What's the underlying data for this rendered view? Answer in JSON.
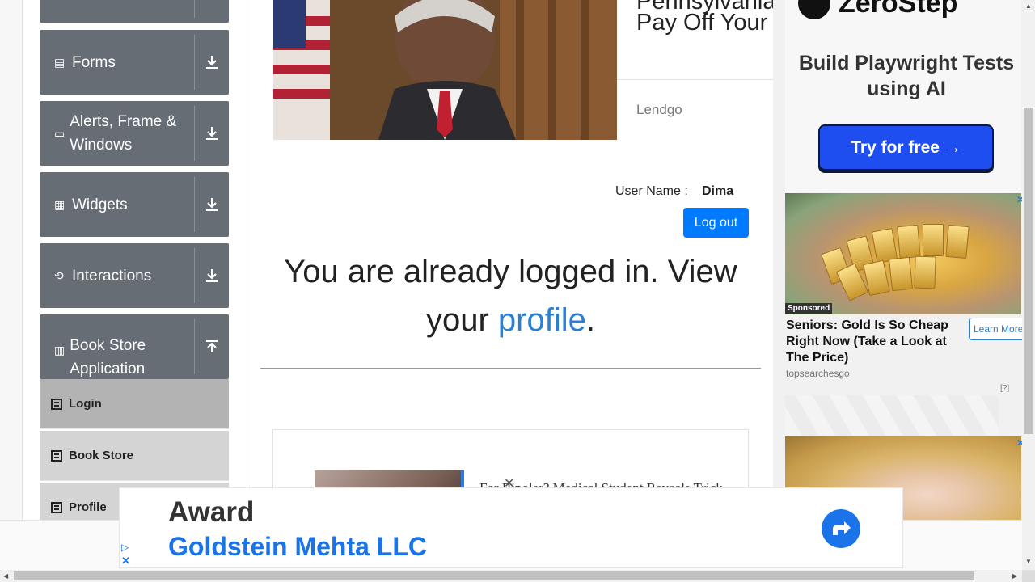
{
  "sidebar": {
    "groups": [
      {
        "label": "",
        "icon": "collapsed-group-icon"
      },
      {
        "label": "Forms",
        "icon": "form-icon"
      },
      {
        "label": "Alerts, Frame & Windows",
        "icon": "window-icon"
      },
      {
        "label": "Widgets",
        "icon": "widgets-icon"
      },
      {
        "label": "Interactions",
        "icon": "interactions-icon"
      },
      {
        "label": "Book Store Application",
        "icon": "book-icon"
      }
    ],
    "items": [
      {
        "label": "Login",
        "active": true
      },
      {
        "label": "Book Store",
        "active": false
      },
      {
        "label": "Profile",
        "active": false
      }
    ]
  },
  "top_ad": {
    "title_line1": "Pennsylvania",
    "title_line2": "Pay Off Your",
    "brand": "Lendgo"
  },
  "user": {
    "label": "User Name :",
    "name": "Dima",
    "logout_label": "Log out"
  },
  "main": {
    "message_prefix": "You are already logged in. View your",
    "message_link": "profile",
    "message_suffix": "."
  },
  "card_ad": {
    "title": "For Bipolar? Medical Student Reveals Trick"
  },
  "right_ads": {
    "zerostep_brand": "ZeroStep",
    "zerostep_tagline": "Build Playwright Tests using AI",
    "zerostep_cta": "Try for free →",
    "sponsored_label": "Sponsored",
    "gold_title": "Seniors: Gold Is So Cheap Right Now (Take a Look at The Price)",
    "gold_cta": "Learn More",
    "gold_source": "topsearchesgo",
    "adchoices": "[?]"
  },
  "bottom_ad": {
    "line1": "Award",
    "line2": "Goldstein Mehta LLC"
  },
  "colors": {
    "sidebar_group": "#676d75",
    "primary": "#007bff",
    "link": "#2a7fd4"
  }
}
